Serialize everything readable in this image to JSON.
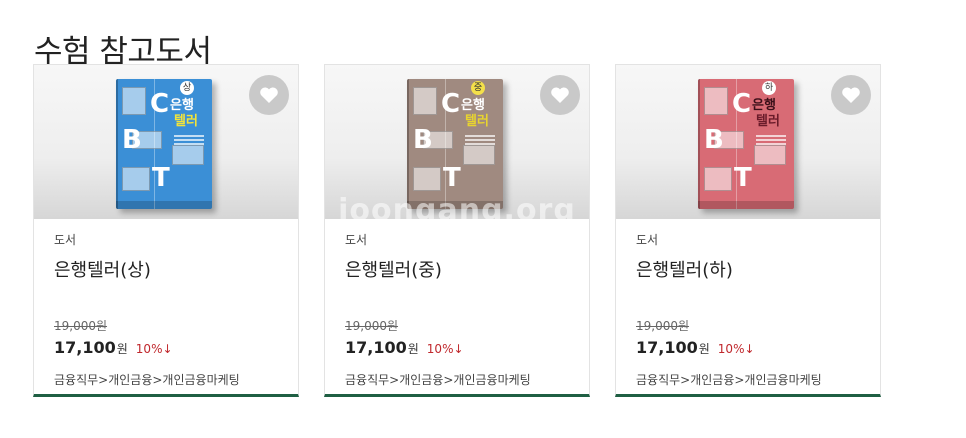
{
  "section": {
    "title": "수험 참고도서"
  },
  "cards": [
    {
      "category": "도서",
      "title": "은행텔러(상)",
      "original_price": "19,000원",
      "sale_price": "17,100",
      "currency_unit": "원",
      "discount": "10%↓",
      "category_path": "금융직무>개인금융>개인금융마케팅",
      "cover": {
        "color": "#3b8fd6",
        "title_top": "은행",
        "title_bottom": "텔러",
        "title_bottom_color": "#f2e43a",
        "badge": "상",
        "letters": [
          "C",
          "B",
          "T"
        ]
      },
      "watermark": ""
    },
    {
      "category": "도서",
      "title": "은행텔러(중)",
      "original_price": "19,000원",
      "sale_price": "17,100",
      "currency_unit": "원",
      "discount": "10%↓",
      "category_path": "금융직무>개인금융>개인금융마케팅",
      "cover": {
        "color": "#a08a80",
        "title_top": "은행",
        "title_bottom": "텔러",
        "title_bottom_color": "#e8d42f",
        "badge": "중",
        "letters": [
          "C",
          "B",
          "T"
        ]
      },
      "watermark": "joongang.org"
    },
    {
      "category": "도서",
      "title": "은행텔러(하)",
      "original_price": "19,000원",
      "sale_price": "17,100",
      "currency_unit": "원",
      "discount": "10%↓",
      "category_path": "금융직무>개인금융>개인금융마케팅",
      "cover": {
        "color": "#d86b75",
        "title_top": "은행",
        "title_bottom": "텔러",
        "title_bottom_color": "#6a1b2a",
        "badge": "하",
        "letters": [
          "C",
          "B",
          "T"
        ]
      },
      "watermark": ""
    }
  ],
  "icons": {
    "wishlist": "heart-icon"
  }
}
